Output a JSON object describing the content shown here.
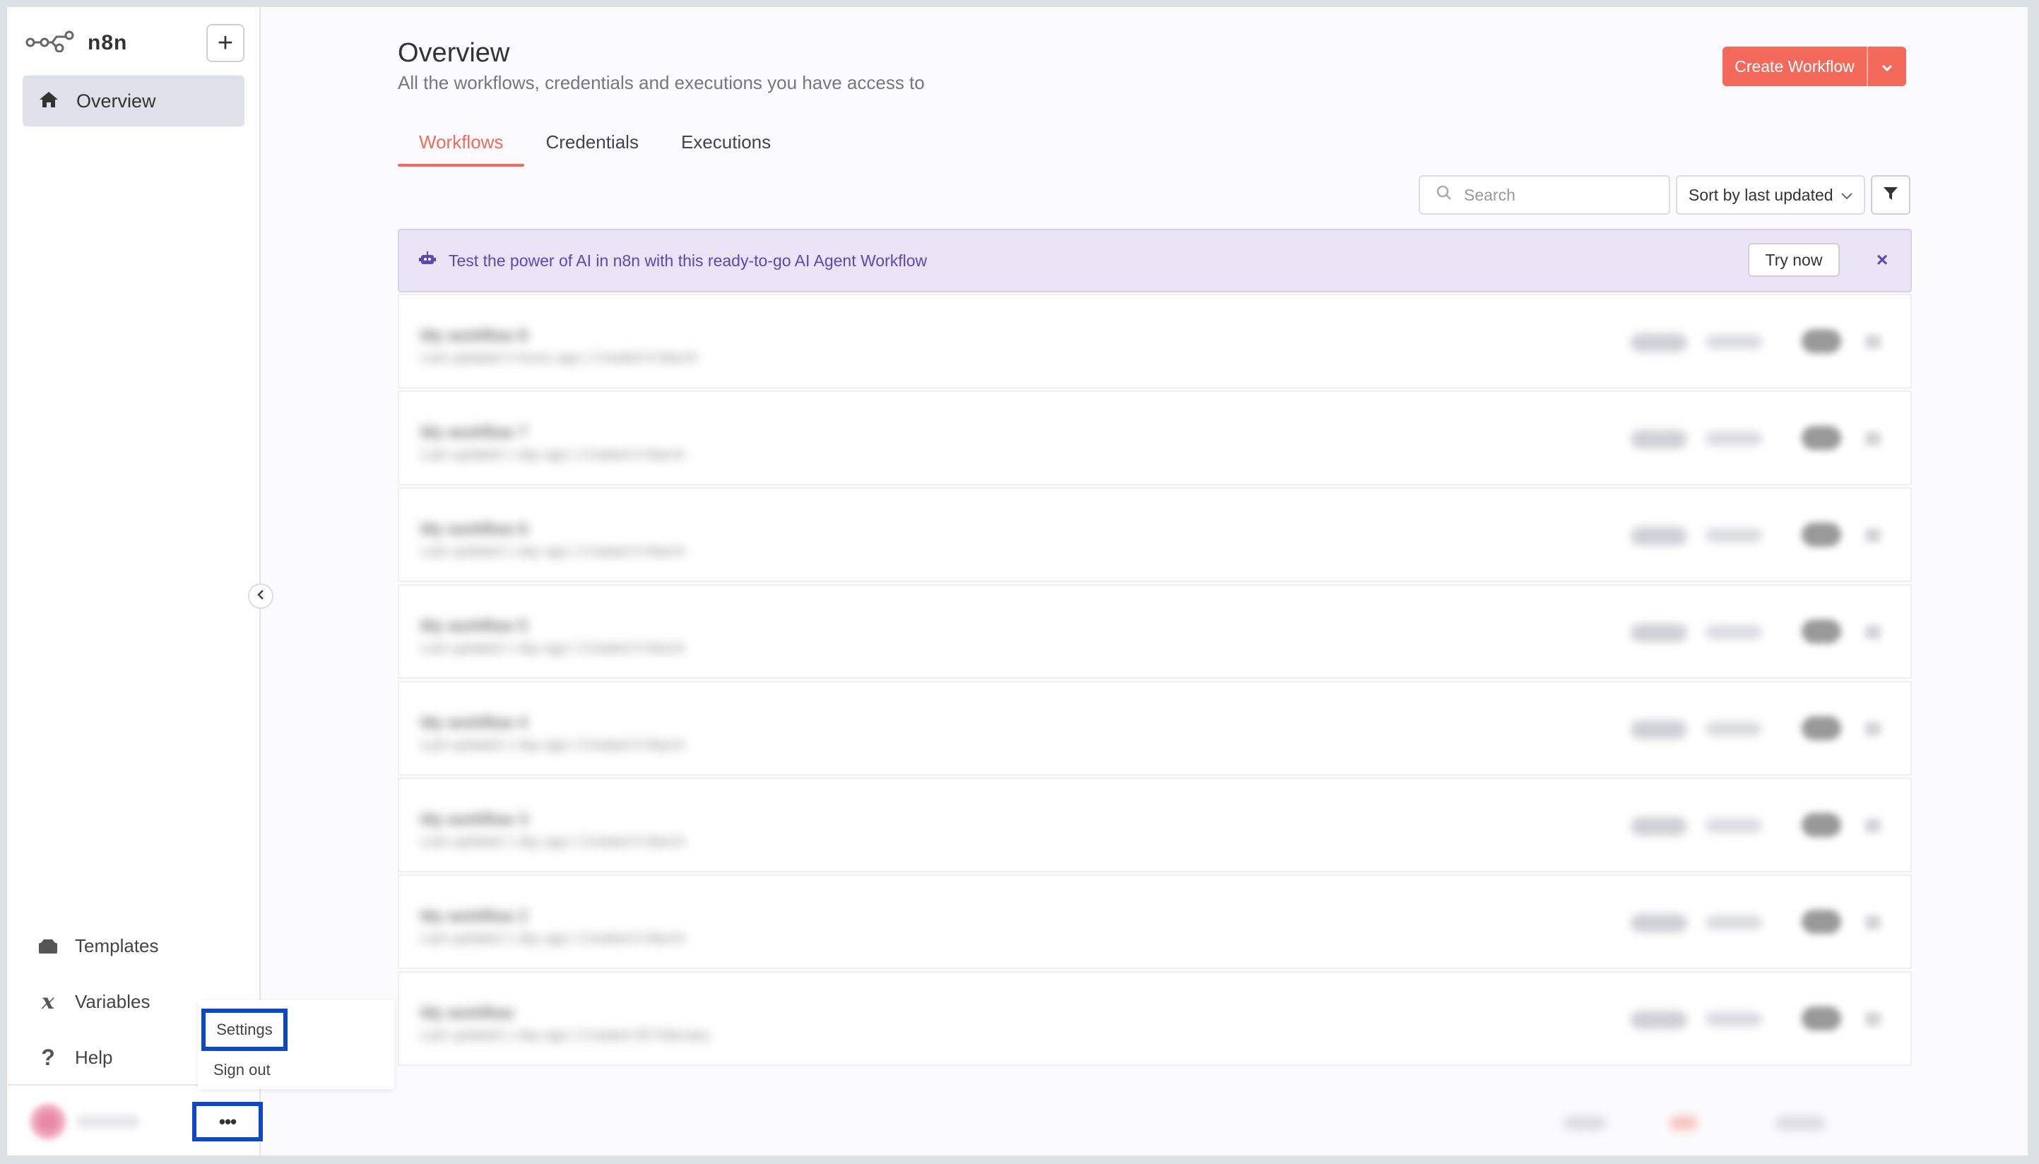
{
  "app": {
    "name": "n8n"
  },
  "sidebar": {
    "items": [
      {
        "label": "Overview",
        "icon": "home-icon"
      }
    ],
    "bottom_items": [
      {
        "label": "Templates",
        "icon": "templates-icon"
      },
      {
        "label": "Variables",
        "icon": "variables-icon"
      },
      {
        "label": "Help",
        "icon": "help-icon"
      }
    ],
    "more_label": "•••"
  },
  "user_menu": {
    "settings": "Settings",
    "sign_out": "Sign out"
  },
  "header": {
    "title": "Overview",
    "subtitle": "All the workflows, credentials and executions you have access to",
    "create_button": "Create Workflow"
  },
  "tabs": [
    {
      "label": "Workflows"
    },
    {
      "label": "Credentials"
    },
    {
      "label": "Executions"
    }
  ],
  "search": {
    "placeholder": "Search"
  },
  "sort": {
    "value": "Sort by last updated"
  },
  "banner": {
    "text": "Test the power of AI in n8n with this ready-to-go AI Agent Workflow",
    "button": "Try now",
    "close": "×"
  },
  "workflows": [
    {
      "name": "My workflow 8",
      "meta": "Last updated 4 hours ago | Created 6 March"
    },
    {
      "name": "My workflow 7",
      "meta": "Last updated 1 day ago | Created 6 March"
    },
    {
      "name": "My workflow 6",
      "meta": "Last updated 1 day ago | Created 6 March"
    },
    {
      "name": "My workflow 5",
      "meta": "Last updated 1 day ago | Created 6 March"
    },
    {
      "name": "My workflow 4",
      "meta": "Last updated 1 day ago | Created 6 March"
    },
    {
      "name": "My workflow 3",
      "meta": "Last updated 1 day ago | Created 6 March"
    },
    {
      "name": "My workflow 2",
      "meta": "Last updated 1 day ago | Created 6 March"
    },
    {
      "name": "My workflow",
      "meta": "Last updated 1 day ago | Created 28 February"
    }
  ],
  "colors": {
    "accent": "#f36a5a",
    "banner_text": "#5b47b8",
    "highlight": "#0d47c9"
  }
}
